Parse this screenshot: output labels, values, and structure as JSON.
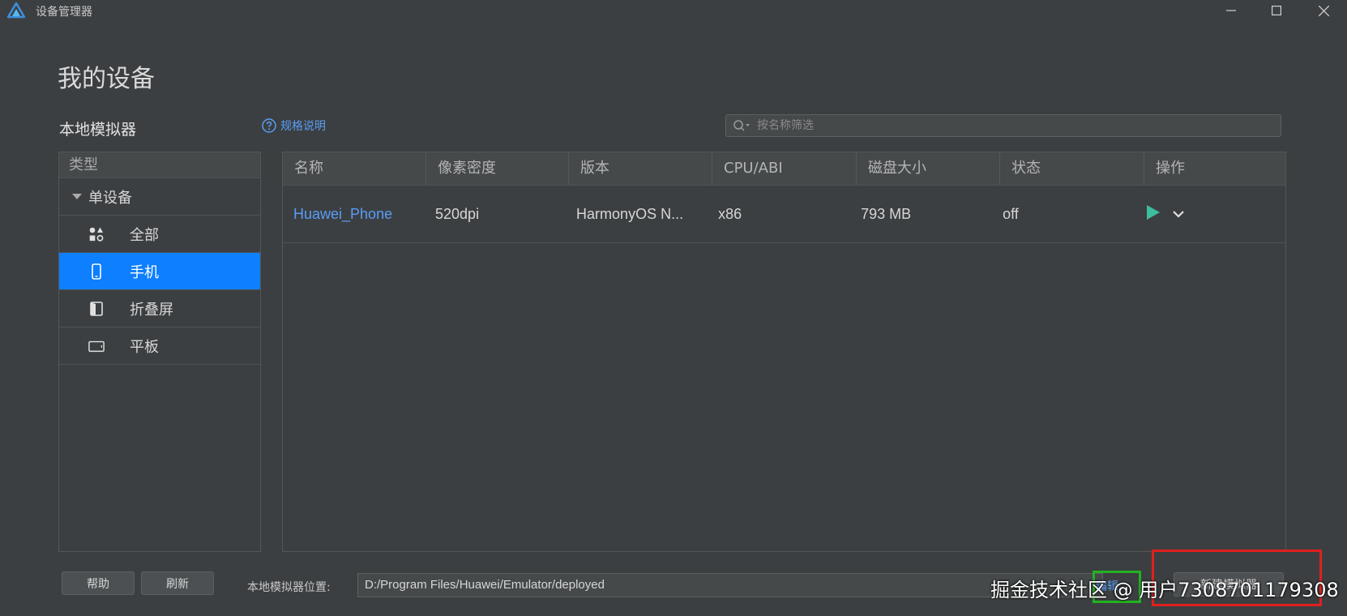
{
  "window": {
    "title": "设备管理器"
  },
  "page": {
    "title": "我的设备",
    "section_title": "本地模拟器",
    "spec_link": "规格说明"
  },
  "search": {
    "placeholder": "按名称筛选",
    "value": ""
  },
  "categories": {
    "header": "类型",
    "group": "单设备",
    "items": [
      {
        "label": "全部",
        "icon": "grid-shapes-icon",
        "selected": false
      },
      {
        "label": "手机",
        "icon": "phone-icon",
        "selected": true
      },
      {
        "label": "折叠屏",
        "icon": "foldable-icon",
        "selected": false
      },
      {
        "label": "平板",
        "icon": "tablet-icon",
        "selected": false
      }
    ]
  },
  "table": {
    "columns": [
      "名称",
      "像素密度",
      "版本",
      "CPU/ABI",
      "磁盘大小",
      "状态",
      "操作"
    ],
    "rows": [
      {
        "name": "Huawei_Phone",
        "density": "520dpi",
        "version": "HarmonyOS N...",
        "cpu": "x86",
        "disk": "793 MB",
        "status": "off"
      }
    ]
  },
  "bottom": {
    "help_label": "帮助",
    "refresh_label": "刷新",
    "location_label": "本地模拟器位置:",
    "location_value": "D:/Program Files/Huawei/Emulator/deployed",
    "edit_label": "编辑",
    "new_emulator_label": "新建模拟器"
  },
  "watermark": "掘金技术社区 @ 用户7308701179308",
  "colors": {
    "background": "#3c3f41",
    "accent": "#0d7fff",
    "link": "#589df6",
    "play": "#3dbd9e",
    "highlight_green": "#22b222",
    "highlight_red": "#e02020"
  }
}
